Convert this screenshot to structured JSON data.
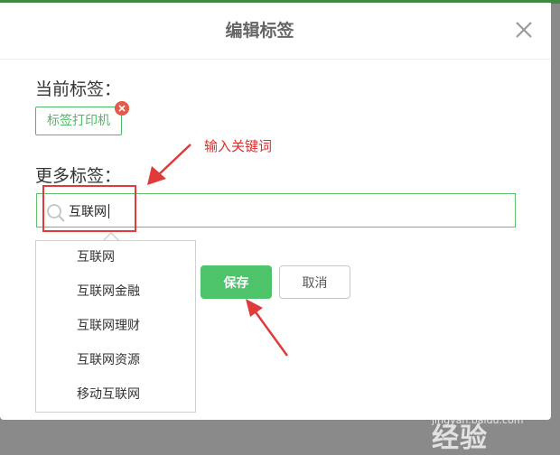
{
  "dialog": {
    "title": "编辑标签",
    "current_tags_label": "当前标签：",
    "current_tags": [
      "标签打印机"
    ],
    "more_tags_label": "更多标签："
  },
  "search": {
    "value": "互联网",
    "suggestions": [
      "互联网",
      "互联网金融",
      "互联网理财",
      "互联网资源",
      "移动互联网"
    ]
  },
  "buttons": {
    "save": "保存",
    "cancel": "取消"
  },
  "annotation": {
    "text": "输入关键词"
  },
  "watermark": {
    "logo": "Baidu 经验",
    "url": "jingyan.baidu.com"
  },
  "colors": {
    "accent_green": "#4ec46a",
    "tag_green": "#4cbb67",
    "annotation_red": "#e03a3a",
    "remove_red": "#e45a4a"
  }
}
